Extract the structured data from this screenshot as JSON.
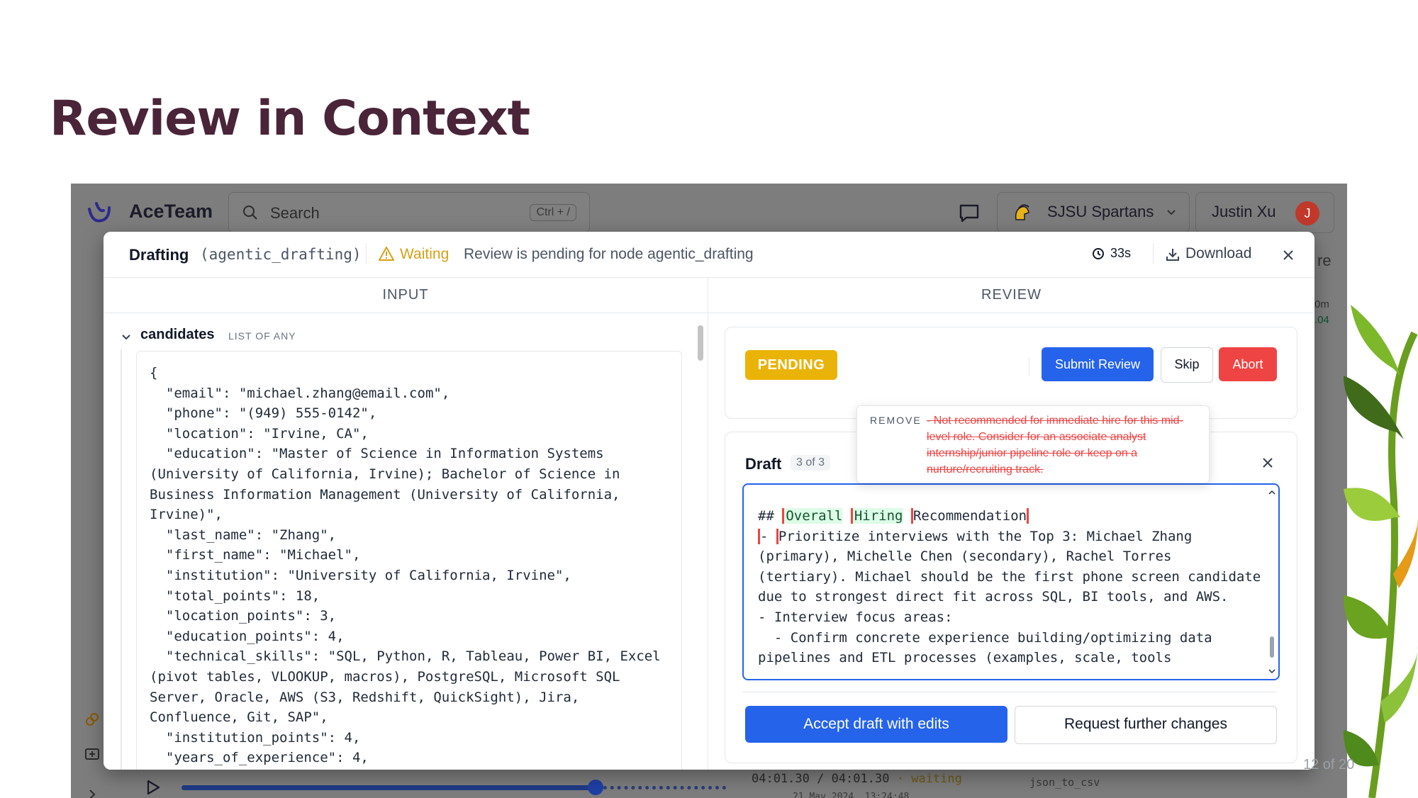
{
  "slide": {
    "title": "Review in Context",
    "page_number": "12 of 20"
  },
  "app": {
    "brand": "AceTeam",
    "search_placeholder": "Search",
    "search_shortcut": "Ctrl + /",
    "team_name": "SJSU Spartans",
    "user_name": "Justin Xu",
    "user_initial": "J",
    "background_fragments": {
      "right_text": "re",
      "right_small_1": "0m",
      "right_small_2": ".04",
      "node_label": "json_to_csv",
      "timecode": "04:01.30 / 04:01.30",
      "timecode_sep": "·",
      "timecode_status": "waiting",
      "timestamp": "21 May 2024, 13:24:48"
    }
  },
  "modal": {
    "title": "Drafting",
    "node_id": "(agentic_drafting)",
    "status_label": "Waiting",
    "status_message": "Review is pending for node agentic_drafting",
    "elapsed": "33s",
    "download_label": "Download",
    "columns": {
      "input": "INPUT",
      "review": "REVIEW"
    }
  },
  "input": {
    "field_name": "candidates",
    "field_type": "LIST OF ANY",
    "json_text": "{\n  \"email\": \"michael.zhang@email.com\",\n  \"phone\": \"(949) 555-0142\",\n  \"location\": \"Irvine, CA\",\n  \"education\": \"Master of Science in Information Systems (University of California, Irvine); Bachelor of Science in Business Information Management (University of California, Irvine)\",\n  \"last_name\": \"Zhang\",\n  \"first_name\": \"Michael\",\n  \"institution\": \"University of California, Irvine\",\n  \"total_points\": 18,\n  \"location_points\": 3,\n  \"education_points\": 4,\n  \"technical_skills\": \"SQL, Python, R, Tableau, Power BI, Excel (pivot tables, VLOOKUP, macros), PostgreSQL, Microsoft SQL Server, Oracle, AWS (S3, Redshift, QuickSight), Jira, Confluence, Git, SAP\",\n  \"institution_points\": 4,\n  \"years_of_experience\": 4,"
  },
  "review": {
    "status": "PENDING",
    "submit_label": "Submit Review",
    "skip_label": "Skip",
    "abort_label": "Abort",
    "draft_title": "Draft",
    "draft_count": "3 of 3",
    "editor": {
      "heading_prefix": "## ",
      "heading_word_1": "Overall",
      "heading_word_2": "Hiring",
      "heading_word_3": "Recommendation",
      "line_2_prefix": "- ",
      "body": "Prioritize interviews with the Top 3: Michael Zhang (primary), Michelle Chen (secondary), Rachel Torres (tertiary). Michael should be the first phone screen candidate due to strongest direct fit across SQL, BI tools, and AWS.\n- Interview focus areas:\n  - Confirm concrete experience building/optimizing data pipelines and ETL processes (examples, scale, tools"
    },
    "accept_label": "Accept draft with edits",
    "request_label": "Request further changes",
    "popover": {
      "label": "REMOVE",
      "text": "- Not recommended for immediate hire for this mid-level role. Consider for an associate analyst internship/junior pipeline role or keep on a nurture/recruiting track."
    }
  },
  "colors": {
    "accent": "#2563eb",
    "pending": "#eab308",
    "abort": "#ef4444",
    "title": "#4a2438"
  }
}
